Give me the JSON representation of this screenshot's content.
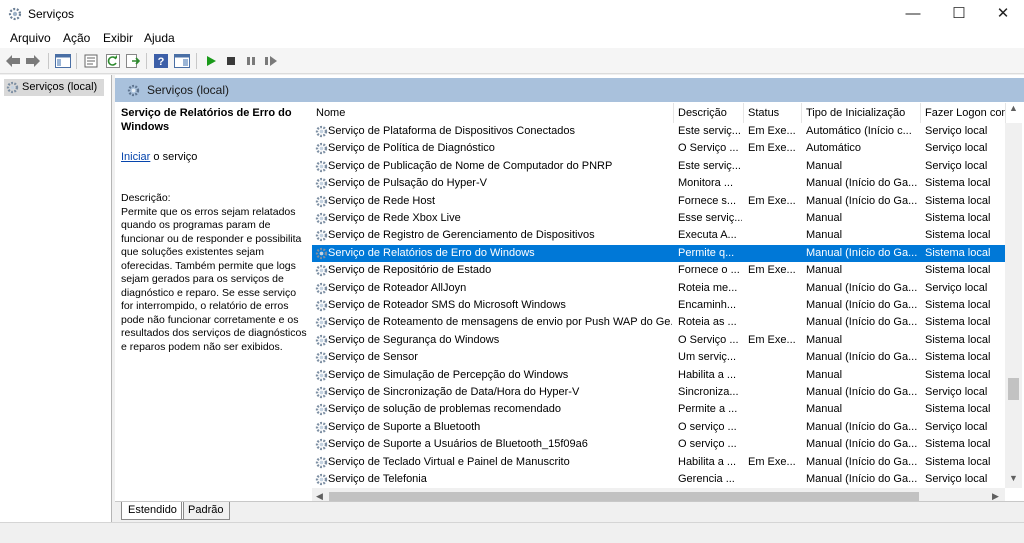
{
  "window": {
    "title": "Serviços",
    "minimize": "—",
    "maximize": "☐",
    "close": "✕"
  },
  "menu": [
    "Arquivo",
    "Ação",
    "Exibir",
    "Ajuda"
  ],
  "tree": {
    "root": "Serviços (local)"
  },
  "pane_header": "Serviços (local)",
  "extended": {
    "title": "Serviço de Relatórios de Erro do Windows",
    "link": "Iniciar",
    "link_suffix": " o serviço",
    "description": "Descrição:\nPermite que os erros sejam relatados quando os programas param de funcionar ou de responder e possibilita que soluções existentes sejam oferecidas. Também permite que logs sejam gerados para os serviços de diagnóstico e reparo. Se esse serviço for interrompido, o relatório de erros pode não funcionar corretamente e os resultados dos serviços de diagnósticos e reparos podem não ser exibidos."
  },
  "columns": [
    "Nome",
    "Descrição",
    "Status",
    "Tipo de Inicialização",
    "Fazer Logon com"
  ],
  "services": [
    [
      "Serviço de Plataforma de Dispositivos Conectados",
      "Este serviç...",
      "Em Exe...",
      "Automático (Início c...",
      "Serviço local"
    ],
    [
      "Serviço de Política de Diagnóstico",
      "O Serviço ...",
      "Em Exe...",
      "Automático",
      "Serviço local"
    ],
    [
      "Serviço de Publicação de Nome de Computador do PNRP",
      "Este serviç...",
      "",
      "Manual",
      "Serviço local"
    ],
    [
      "Serviço de Pulsação do Hyper-V",
      "Monitora ...",
      "",
      "Manual (Início do Ga...",
      "Sistema local"
    ],
    [
      "Serviço de Rede Host",
      "Fornece s...",
      "Em Exe...",
      "Manual (Início do Ga...",
      "Sistema local"
    ],
    [
      "Serviço de Rede Xbox Live",
      "Esse serviç...",
      "",
      "Manual",
      "Sistema local"
    ],
    [
      "Serviço de Registro de Gerenciamento de Dispositivos",
      "Executa A...",
      "",
      "Manual",
      "Sistema local"
    ],
    [
      "Serviço de Relatórios de Erro do Windows",
      "Permite q...",
      "",
      "Manual (Início do Ga...",
      "Sistema local"
    ],
    [
      "Serviço de Repositório de Estado",
      "Fornece o ...",
      "Em Exe...",
      "Manual",
      "Sistema local"
    ],
    [
      "Serviço de Roteador AllJoyn",
      "Roteia me...",
      "",
      "Manual (Início do Ga...",
      "Serviço local"
    ],
    [
      "Serviço de Roteador SMS do Microsoft Windows",
      "Encaminh...",
      "",
      "Manual (Início do Ga...",
      "Sistema local"
    ],
    [
      "Serviço de Roteamento de mensagens de envio por Push WAP do Ge...",
      "Roteia as ...",
      "",
      "Manual (Início do Ga...",
      "Sistema local"
    ],
    [
      "Serviço de Segurança do Windows",
      "O Serviço ...",
      "Em Exe...",
      "Manual",
      "Sistema local"
    ],
    [
      "Serviço de Sensor",
      "Um serviç...",
      "",
      "Manual (Início do Ga...",
      "Sistema local"
    ],
    [
      "Serviço de Simulação de Percepção do Windows",
      "Habilita a ...",
      "",
      "Manual",
      "Sistema local"
    ],
    [
      "Serviço de Sincronização de Data/Hora do Hyper-V",
      "Sincroniza...",
      "",
      "Manual (Início do Ga...",
      "Serviço local"
    ],
    [
      "Serviço de solução de problemas recomendado",
      "Permite a ...",
      "",
      "Manual",
      "Sistema local"
    ],
    [
      "Serviço de Suporte a Bluetooth",
      "O serviço ...",
      "",
      "Manual (Início do Ga...",
      "Serviço local"
    ],
    [
      "Serviço de Suporte a Usuários de Bluetooth_15f09a6",
      "O serviço ...",
      "",
      "Manual (Início do Ga...",
      "Sistema local"
    ],
    [
      "Serviço de Teclado Virtual e Painel de Manuscrito",
      "Habilita a ...",
      "Em Exe...",
      "Manual (Início do Ga...",
      "Sistema local"
    ],
    [
      "Serviço de Telefonia",
      "Gerencia ...",
      "",
      "Manual (Início do Ga...",
      "Serviço local"
    ]
  ],
  "selected_index": 7,
  "tabs": [
    "Estendido",
    "Padrão"
  ],
  "colors": {
    "selection": "#0078d7",
    "pane_header": "#a9c1dc",
    "link": "#0645ad"
  },
  "icons": [
    "services-app-icon",
    "back-icon",
    "forward-icon",
    "show-hide-tree-icon",
    "properties-icon",
    "refresh-icon",
    "export-icon",
    "help-icon",
    "view-icon",
    "start-icon",
    "stop-icon",
    "pause-icon",
    "restart-icon",
    "gear-icon"
  ]
}
